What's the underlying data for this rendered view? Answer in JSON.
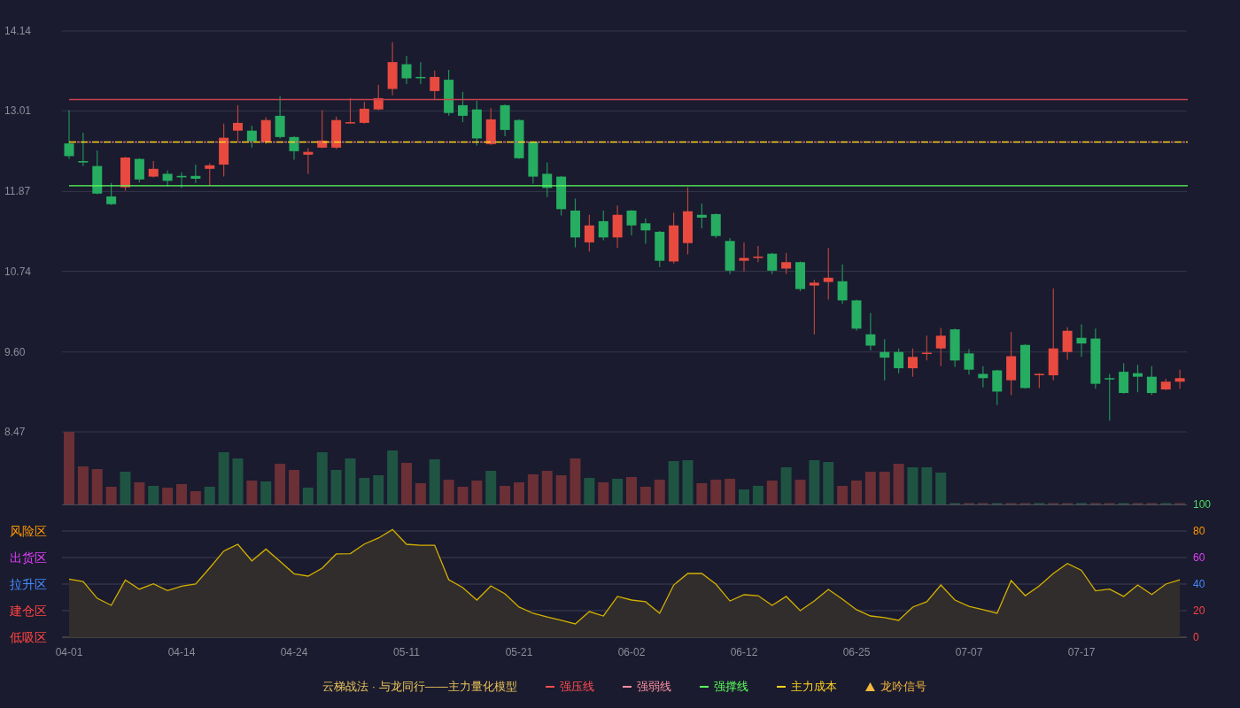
{
  "price_chart": {
    "chart_data": {
      "type": "candlestick",
      "grid": true,
      "ylim": [
        8.47,
        14.14
      ],
      "yticks": [
        {
          "value": 14.14,
          "label": "14.14"
        },
        {
          "value": 13.01,
          "label": "13.01"
        },
        {
          "value": 11.87,
          "label": "11.87"
        },
        {
          "value": 10.74,
          "label": "10.74"
        },
        {
          "value": 9.6,
          "label": "9.60"
        },
        {
          "value": 8.47,
          "label": "8.47"
        }
      ],
      "categories": [
        null,
        null,
        null,
        null,
        null,
        null,
        null,
        null,
        null,
        null,
        null,
        null,
        null,
        null,
        null,
        null,
        null,
        null,
        null,
        null,
        null,
        null,
        null,
        null,
        null,
        null,
        null,
        null,
        null,
        null,
        null,
        null,
        null,
        null,
        null,
        null,
        null,
        null,
        null,
        null,
        null,
        null,
        null,
        null,
        null,
        null,
        null,
        null,
        null,
        null,
        null,
        null,
        null,
        null,
        null,
        null,
        null,
        null,
        null,
        null,
        null,
        null,
        null,
        null,
        null,
        null,
        null,
        null,
        null,
        null,
        null,
        null,
        null,
        null,
        null,
        null,
        null,
        null,
        null,
        null
      ],
      "ohlc": [
        [
          12.55,
          13.02,
          12.33,
          12.37
        ],
        [
          12.3,
          12.7,
          12.23,
          12.28
        ],
        [
          12.23,
          12.45,
          11.83,
          11.84
        ],
        [
          11.8,
          11.99,
          11.68,
          11.69
        ],
        [
          11.93,
          12.36,
          11.88,
          12.35
        ],
        [
          12.33,
          12.34,
          12.0,
          12.04
        ],
        [
          12.08,
          12.3,
          12.07,
          12.19
        ],
        [
          12.12,
          12.17,
          11.94,
          12.02
        ],
        [
          12.09,
          12.14,
          11.92,
          12.07
        ],
        [
          12.09,
          12.25,
          11.99,
          12.05
        ],
        [
          12.19,
          12.27,
          11.95,
          12.24
        ],
        [
          12.25,
          12.83,
          12.08,
          12.63
        ],
        [
          12.73,
          13.09,
          12.58,
          12.84
        ],
        [
          12.73,
          12.8,
          12.49,
          12.58
        ],
        [
          12.57,
          12.92,
          12.54,
          12.88
        ],
        [
          12.94,
          13.22,
          12.62,
          12.64
        ],
        [
          12.64,
          12.65,
          12.32,
          12.44
        ],
        [
          12.39,
          12.48,
          12.12,
          12.43
        ],
        [
          12.49,
          13.02,
          12.48,
          12.59
        ],
        [
          12.49,
          12.93,
          12.47,
          12.88
        ],
        [
          12.84,
          13.19,
          12.83,
          12.85
        ],
        [
          12.84,
          13.14,
          12.83,
          13.04
        ],
        [
          13.03,
          13.38,
          13.02,
          13.19
        ],
        [
          13.32,
          13.98,
          13.23,
          13.7
        ],
        [
          13.67,
          13.79,
          13.39,
          13.47
        ],
        [
          13.49,
          13.7,
          13.39,
          13.48
        ],
        [
          13.29,
          13.58,
          13.17,
          13.49
        ],
        [
          13.45,
          13.59,
          12.94,
          12.98
        ],
        [
          13.09,
          13.28,
          12.85,
          12.94
        ],
        [
          13.03,
          13.15,
          12.52,
          12.62
        ],
        [
          12.54,
          13.05,
          12.53,
          12.89
        ],
        [
          13.09,
          13.1,
          12.65,
          12.74
        ],
        [
          12.88,
          12.89,
          12.33,
          12.34
        ],
        [
          12.57,
          12.58,
          11.98,
          12.08
        ],
        [
          12.12,
          12.28,
          11.79,
          11.92
        ],
        [
          12.08,
          12.09,
          11.53,
          11.62
        ],
        [
          11.6,
          11.77,
          11.08,
          11.22
        ],
        [
          11.15,
          11.54,
          11.02,
          11.39
        ],
        [
          11.45,
          11.6,
          11.18,
          11.22
        ],
        [
          11.22,
          11.67,
          11.07,
          11.54
        ],
        [
          11.6,
          11.61,
          11.25,
          11.39
        ],
        [
          11.42,
          11.49,
          11.13,
          11.32
        ],
        [
          11.3,
          11.31,
          10.8,
          10.89
        ],
        [
          10.88,
          11.57,
          10.85,
          11.39
        ],
        [
          11.14,
          11.93,
          10.98,
          11.59
        ],
        [
          11.54,
          11.7,
          11.35,
          11.5
        ],
        [
          11.55,
          11.56,
          11.21,
          11.24
        ],
        [
          11.17,
          11.21,
          10.7,
          10.75
        ],
        [
          10.89,
          11.15,
          10.74,
          10.93
        ],
        [
          10.93,
          11.1,
          10.87,
          10.95
        ],
        [
          10.99,
          11.0,
          10.7,
          10.75
        ],
        [
          10.78,
          11.0,
          10.7,
          10.87
        ],
        [
          10.87,
          10.88,
          10.46,
          10.49
        ],
        [
          10.54,
          10.62,
          9.85,
          10.58
        ],
        [
          10.59,
          11.07,
          10.34,
          10.65
        ],
        [
          10.6,
          10.84,
          10.28,
          10.33
        ],
        [
          10.33,
          10.34,
          9.9,
          9.93
        ],
        [
          9.85,
          10.15,
          9.62,
          9.69
        ],
        [
          9.6,
          9.78,
          9.2,
          9.52
        ],
        [
          9.6,
          9.65,
          9.3,
          9.37
        ],
        [
          9.37,
          9.65,
          9.25,
          9.53
        ],
        [
          9.58,
          9.83,
          9.48,
          9.59
        ],
        [
          9.65,
          9.94,
          9.4,
          9.83
        ],
        [
          9.92,
          9.93,
          9.39,
          9.48
        ],
        [
          9.58,
          9.64,
          9.28,
          9.35
        ],
        [
          9.29,
          9.4,
          9.1,
          9.23
        ],
        [
          9.34,
          9.35,
          8.85,
          9.04
        ],
        [
          9.2,
          9.88,
          8.99,
          9.54
        ],
        [
          9.7,
          9.71,
          9.08,
          9.09
        ],
        [
          9.28,
          9.3,
          9.09,
          9.29
        ],
        [
          9.27,
          10.5,
          9.2,
          9.65
        ],
        [
          9.6,
          9.95,
          9.49,
          9.9
        ],
        [
          9.8,
          9.99,
          9.53,
          9.72
        ],
        [
          9.79,
          9.93,
          9.08,
          9.15
        ],
        [
          9.23,
          9.29,
          8.63,
          9.22
        ],
        [
          9.32,
          9.44,
          9.01,
          9.02
        ],
        [
          9.3,
          9.42,
          9.03,
          9.25
        ],
        [
          9.25,
          9.4,
          8.99,
          9.02
        ],
        [
          9.07,
          9.22,
          9.06,
          9.18
        ],
        [
          9.18,
          9.35,
          9.08,
          9.23
        ]
      ],
      "ref_lines": [
        {
          "axis": "y",
          "value": 13.17,
          "color": "#c8424e"
        },
        {
          "axis": "y",
          "value": 12.57,
          "color": "#c9708a"
        },
        {
          "axis": "y",
          "value": 11.95,
          "color": "#5cff5c"
        },
        {
          "axis": "y",
          "value": 12.57,
          "color": "#ffd21f"
        }
      ]
    }
  },
  "indicator": {
    "zones": [
      {
        "label": "风险区",
        "color": "#ff9800"
      },
      {
        "label": "出货区",
        "color": "#e040fb"
      },
      {
        "label": "拉升区",
        "color": "#448aff"
      },
      {
        "label": "建仓区",
        "color": "#ff4444"
      },
      {
        "label": "低吸区",
        "color": "#ff4444"
      }
    ],
    "chart_data": {
      "type": "area",
      "grid": true,
      "ylim": [
        0,
        100
      ],
      "yticks": [
        {
          "value": 100,
          "label": "100"
        },
        {
          "value": 80,
          "label": "80"
        },
        {
          "value": 60,
          "label": "60"
        },
        {
          "value": 40,
          "label": "40"
        },
        {
          "value": 20,
          "label": "20"
        },
        {
          "value": 0,
          "label": "0"
        }
      ],
      "categories": [
        "04-01",
        null,
        null,
        null,
        null,
        null,
        null,
        null,
        "04-14",
        null,
        null,
        null,
        null,
        null,
        null,
        null,
        "04-24",
        null,
        null,
        null,
        null,
        null,
        null,
        null,
        "05-11",
        null,
        null,
        null,
        null,
        null,
        null,
        null,
        "05-21",
        null,
        null,
        null,
        null,
        null,
        null,
        null,
        "06-02",
        null,
        null,
        null,
        null,
        null,
        null,
        null,
        "06-12",
        null,
        null,
        null,
        null,
        null,
        null,
        null,
        "06-25",
        null,
        null,
        null,
        null,
        null,
        null,
        null,
        "07-07",
        null,
        null,
        null,
        null,
        null,
        null,
        null,
        "07-17",
        null,
        null,
        null,
        null,
        null,
        null,
        null
      ],
      "series": [
        {
          "color": "#d4b000",
          "values": [
            43.8,
            42,
            29.3,
            24,
            43,
            36.2,
            40.2,
            35.1,
            38.4,
            40,
            52.2,
            64.9,
            70,
            57.5,
            66.4,
            57.1,
            47.8,
            46,
            52,
            62.7,
            62.9,
            70.2,
            74.7,
            81.1,
            70,
            69.3,
            69.3,
            43.3,
            37.3,
            28,
            38.7,
            32.7,
            22.7,
            18,
            15.3,
            12.7,
            10,
            19.3,
            16,
            30.7,
            28,
            26.7,
            18,
            39.3,
            48,
            48,
            40,
            27.3,
            32,
            31.3,
            24,
            30.7,
            20,
            27.3,
            36,
            28.7,
            20.7,
            16,
            14.7,
            12.7,
            22.7,
            26.7,
            39.3,
            28,
            23.3,
            20.7,
            18,
            42.7,
            31.3,
            38.7,
            48,
            55.5,
            50.4,
            34.9,
            36.2,
            30.7,
            39.3,
            32.2,
            40,
            43.3
          ]
        }
      ]
    }
  },
  "legend": {
    "title": "云梯战法 · 与龙同行——主力量化模型",
    "items": [
      {
        "kind": "line",
        "label": "强压线",
        "color": "#ff4d4f"
      },
      {
        "kind": "dashed",
        "label": "强弱线",
        "color": "#ff8fa3"
      },
      {
        "kind": "line",
        "label": "强撑线",
        "color": "#5cff5c"
      },
      {
        "kind": "dashed",
        "label": "主力成本",
        "color": "#ffd21f"
      },
      {
        "kind": "triangle",
        "label": "龙吟信号",
        "color": "#f5b83d"
      }
    ]
  }
}
